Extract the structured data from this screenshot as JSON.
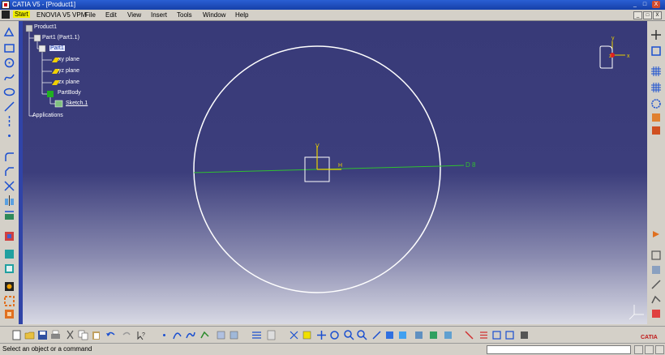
{
  "window": {
    "title": "CATIA V5 - [Product1]",
    "buttons": [
      "_",
      "□",
      "X"
    ]
  },
  "menubar": {
    "items": [
      "Start",
      "ENOVIA V5 VPM",
      "File",
      "Edit",
      "View",
      "Insert",
      "Tools",
      "Window",
      "Help"
    ],
    "active": "Start",
    "mdi_buttons": [
      "_",
      "□",
      "X"
    ]
  },
  "tree": {
    "product": "Product1",
    "part_instance": "Part1 (Part1.1)",
    "part": "Part1",
    "planes": [
      "xy plane",
      "yz plane",
      "zx plane"
    ],
    "body": "PartBody",
    "sketch": "Sketch.1",
    "applications": "Applications"
  },
  "sketch": {
    "axis_v_label": "V",
    "axis_h_label": "H",
    "dimension_label": "D 8"
  },
  "compass": {
    "y_label": "y",
    "x_label": "x",
    "z_label": "z"
  },
  "status": {
    "message": "Select an object or a command",
    "command_value": ""
  },
  "colors": {
    "viewport_top": "#383a78",
    "viewport_bottom": "#d8d9e4",
    "sketch_line": "#ffffff",
    "dimension": "#30c030",
    "axis": "#e8d000",
    "title_bar": "#1f4fc0"
  },
  "icons": {
    "left": [
      "sketcher-icon",
      "rectangle-icon",
      "circle-icon",
      "spline-icon",
      "ellipse-icon",
      "line-icon",
      "axis-icon",
      "point-icon",
      "corner-icon",
      "chamfer-icon",
      "trim-icon",
      "mirror-icon",
      "project-3d-icon",
      "constraint-icon",
      "animate-constraint-icon",
      "update-icon",
      "measure-icon",
      "exit-workbench-icon"
    ],
    "right": [
      "compass-icon",
      "sketch-icon",
      "grid-icon",
      "snap-icon",
      "construction-icon",
      "geometrical-constraint-icon",
      "dimensional-constraint-icon",
      "exit-sketch-icon",
      "normal-view-icon",
      "cut-part-icon",
      "sketch-analysis-icon"
    ],
    "bottom": [
      "new-icon",
      "open-icon",
      "save-icon",
      "print-icon",
      "cut-icon",
      "copy-icon",
      "paste-icon",
      "undo-icon",
      "redo-icon",
      "whats-this-icon",
      "point-icon",
      "arc-icon",
      "spline-icon",
      "profile-icon",
      "three-point-icon",
      "line-icon",
      "fit-all-icon",
      "pan-icon",
      "rotate-icon",
      "zoom-in-icon",
      "zoom-out-icon",
      "normal-view-icon",
      "iso-view-icon",
      "shading-icon",
      "hide-show-icon",
      "swap-icon",
      "sketch-solver-icon",
      "measure-icon",
      "grid-icon",
      "snap-icon",
      "construction-icon",
      "constraint-icon",
      "dimension-icon"
    ]
  }
}
